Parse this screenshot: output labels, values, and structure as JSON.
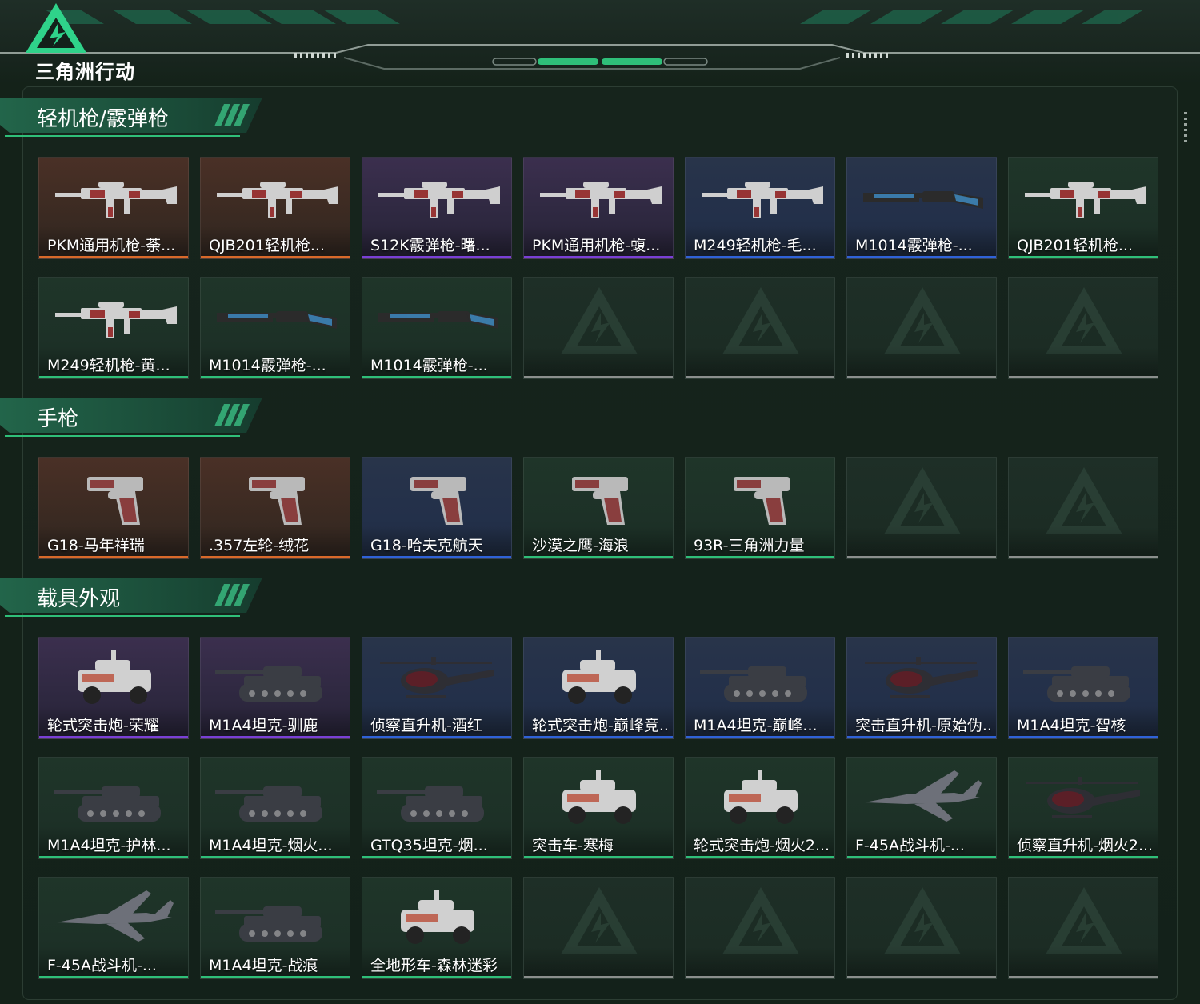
{
  "brand": {
    "name": "三角洲行动",
    "accent": "#2fbf79"
  },
  "rarity_colors": {
    "orange": "#d9692a",
    "purple": "#7a3fd6",
    "blue": "#2f62d8",
    "green": "#2fbf79",
    "empty": "#8b8f8d"
  },
  "sections": [
    {
      "title": "轻机枪/霰弹枪",
      "items": [
        {
          "name": "PKM通用机枪-荼...",
          "rarity": "orange",
          "kind": "rifle"
        },
        {
          "name": "QJB201轻机枪...",
          "rarity": "orange",
          "kind": "rifle"
        },
        {
          "name": "S12K霰弹枪-曙...",
          "rarity": "purple",
          "kind": "rifle"
        },
        {
          "name": "PKM通用机枪-蝮...",
          "rarity": "purple",
          "kind": "rifle"
        },
        {
          "name": "M249轻机枪-毛...",
          "rarity": "blue",
          "kind": "rifle"
        },
        {
          "name": "M1014霰弹枪-...",
          "rarity": "blue",
          "kind": "shotgun"
        },
        {
          "name": "QJB201轻机枪...",
          "rarity": "green",
          "kind": "rifle"
        },
        {
          "name": "M249轻机枪-黄...",
          "rarity": "green",
          "kind": "rifle"
        },
        {
          "name": "M1014霰弹枪-...",
          "rarity": "green",
          "kind": "shotgun"
        },
        {
          "name": "M1014霰弹枪-...",
          "rarity": "green",
          "kind": "shotgun"
        },
        {
          "name": "",
          "rarity": "empty",
          "kind": "empty"
        },
        {
          "name": "",
          "rarity": "empty",
          "kind": "empty"
        },
        {
          "name": "",
          "rarity": "empty",
          "kind": "empty"
        },
        {
          "name": "",
          "rarity": "empty",
          "kind": "empty"
        }
      ]
    },
    {
      "title": "手枪",
      "items": [
        {
          "name": "G18-马年祥瑞",
          "rarity": "orange",
          "kind": "pistol"
        },
        {
          "name": ".357左轮-绒花",
          "rarity": "orange",
          "kind": "pistol"
        },
        {
          "name": "G18-哈夫克航天",
          "rarity": "blue",
          "kind": "pistol"
        },
        {
          "name": "沙漠之鹰-海浪",
          "rarity": "green",
          "kind": "pistol"
        },
        {
          "name": "93R-三角洲力量",
          "rarity": "green",
          "kind": "pistol"
        },
        {
          "name": "",
          "rarity": "empty",
          "kind": "empty"
        },
        {
          "name": "",
          "rarity": "empty",
          "kind": "empty"
        }
      ]
    },
    {
      "title": "载具外观",
      "items": [
        {
          "name": "轮式突击炮-荣耀",
          "rarity": "purple",
          "kind": "car"
        },
        {
          "name": "M1A4坦克-驯鹿",
          "rarity": "purple",
          "kind": "tank"
        },
        {
          "name": "侦察直升机-酒红",
          "rarity": "blue",
          "kind": "heli"
        },
        {
          "name": "轮式突击炮-巅峰竞...",
          "rarity": "blue",
          "kind": "car"
        },
        {
          "name": "M1A4坦克-巅峰...",
          "rarity": "blue",
          "kind": "tank"
        },
        {
          "name": "突击直升机-原始伪...",
          "rarity": "blue",
          "kind": "heli"
        },
        {
          "name": "M1A4坦克-智核",
          "rarity": "blue",
          "kind": "tank"
        },
        {
          "name": "M1A4坦克-护林...",
          "rarity": "green",
          "kind": "tank"
        },
        {
          "name": "M1A4坦克-烟火...",
          "rarity": "green",
          "kind": "tank"
        },
        {
          "name": "GTQ35坦克-烟...",
          "rarity": "green",
          "kind": "tank"
        },
        {
          "name": "突击车-寒梅",
          "rarity": "green",
          "kind": "car"
        },
        {
          "name": "轮式突击炮-烟火2...",
          "rarity": "green",
          "kind": "car"
        },
        {
          "name": "F-45A战斗机-...",
          "rarity": "green",
          "kind": "jet"
        },
        {
          "name": "侦察直升机-烟火2...",
          "rarity": "green",
          "kind": "heli"
        },
        {
          "name": "F-45A战斗机-...",
          "rarity": "green",
          "kind": "jet"
        },
        {
          "name": "M1A4坦克-战痕",
          "rarity": "green",
          "kind": "tank"
        },
        {
          "name": "全地形车-森林迷彩",
          "rarity": "green",
          "kind": "car"
        },
        {
          "name": "",
          "rarity": "empty",
          "kind": "empty"
        },
        {
          "name": "",
          "rarity": "empty",
          "kind": "empty"
        },
        {
          "name": "",
          "rarity": "empty",
          "kind": "empty"
        },
        {
          "name": "",
          "rarity": "empty",
          "kind": "empty"
        }
      ]
    }
  ]
}
